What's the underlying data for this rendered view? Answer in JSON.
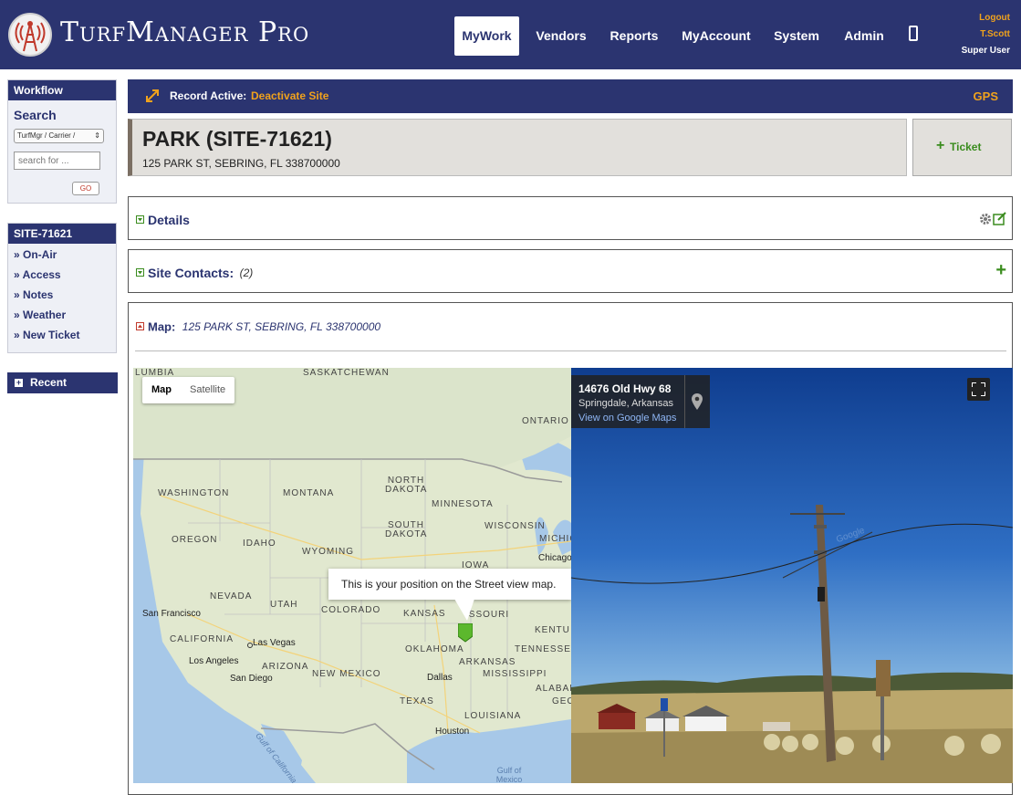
{
  "app": {
    "title": "TurfManager Pro",
    "nav": [
      "MyWork",
      "Vendors",
      "Reports",
      "MyAccount",
      "System",
      "Admin"
    ],
    "active_nav": "MyWork",
    "user_links": {
      "logout": "Logout",
      "user": "T.Scott",
      "role": "Super User"
    }
  },
  "sidebar": {
    "workflow_title": "Workflow",
    "search_title": "Search",
    "search_select": "TurfMgr / Carrier /",
    "search_placeholder": "search for ...",
    "go_label": "GO",
    "site_title": "SITE-71621",
    "site_links": [
      "» On-Air",
      "» Access",
      "» Notes",
      "» Weather",
      "» New Ticket"
    ],
    "recent_title": "Recent"
  },
  "record_bar": {
    "label": "Record Active:",
    "action": "Deactivate Site",
    "gps": "GPS"
  },
  "site": {
    "title": "PARK (SITE-71621)",
    "address": "125 PARK ST, SEBRING, FL 338700000",
    "ticket_label": "Ticket"
  },
  "details": {
    "label": "Details"
  },
  "contacts": {
    "label": "Site Contacts:",
    "count": "(2)"
  },
  "map_panel": {
    "label": "Map:",
    "address": "125 PARK ST, SEBRING, FL 338700000"
  },
  "map": {
    "type_buttons": [
      "Map",
      "Satellite"
    ],
    "tooltip": "This is your position on the Street view map.",
    "regions": [
      "LUMBIA",
      "SASKATCHEWAN",
      "ONTARIO",
      "WASHINGTON",
      "MONTANA",
      "NORTH DAKOTA",
      "MINNESOTA",
      "SOUTH DAKOTA",
      "WISCONSIN",
      "MICHIG",
      "OREGON",
      "IDAHO",
      "WYOMING",
      "IOWA",
      "NEVADA",
      "UTAH",
      "COLORADO",
      "KANSAS",
      "ISSOURI",
      "KENTU",
      "CALIFORNIA",
      "ARIZONA",
      "OKLAHOMA",
      "ARKANSAS",
      "TENNESSEE",
      "NEW MEXICO",
      "MISSISSIPPI",
      "ALABAMA",
      "TEXAS",
      "LOUISIANA",
      "GEO"
    ],
    "cities": [
      "Chicago",
      "San Francisco",
      "Las Vegas",
      "Los Angeles",
      "San Diego",
      "Dallas",
      "Houston"
    ],
    "water": [
      "Gulf of California",
      "Gulf of Mexico"
    ]
  },
  "street_view": {
    "address": "14676 Old Hwy 68",
    "locality": "Springdale, Arkansas",
    "link": "View on Google Maps",
    "watermark": "Google"
  },
  "colors": {
    "header": "#2b3470",
    "accent": "#f0a21c",
    "green": "#3a8c1e",
    "red": "#c0392b"
  }
}
